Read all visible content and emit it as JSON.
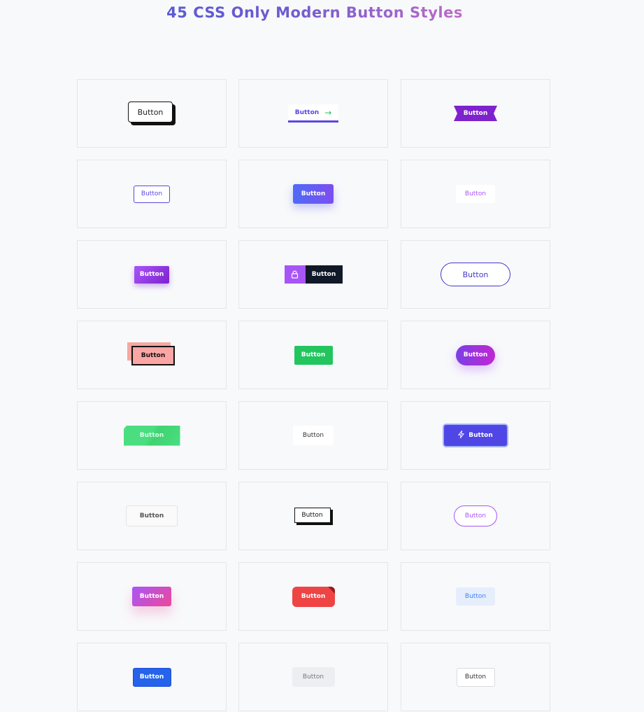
{
  "page": {
    "title": "45 CSS Only Modern Button Styles"
  },
  "buttons": [
    {
      "label": "Button"
    },
    {
      "label": "Button",
      "icon": "arrow-right-icon"
    },
    {
      "label": "Button"
    },
    {
      "label": "Button"
    },
    {
      "label": "Button"
    },
    {
      "label": "Button"
    },
    {
      "label": "Button"
    },
    {
      "label": "Button",
      "icon": "lock-icon"
    },
    {
      "label": "Button"
    },
    {
      "label": "Button"
    },
    {
      "label": "Button"
    },
    {
      "label": "Button"
    },
    {
      "label": "Button"
    },
    {
      "label": "Button"
    },
    {
      "label": "Button",
      "icon": "lightning-icon"
    },
    {
      "label": "Button"
    },
    {
      "label": "Button"
    },
    {
      "label": "Button"
    },
    {
      "label": "Button"
    },
    {
      "label": "Button"
    },
    {
      "label": "Button"
    },
    {
      "label": "Button"
    },
    {
      "label": "Button"
    },
    {
      "label": "Button"
    }
  ],
  "colors": {
    "background": "#f8f9fb",
    "card_border": "#e4e6ea",
    "title_gradient": [
      "#3b5bdb",
      "#6d5bd0",
      "#c26cc7",
      "#ec6b9e"
    ]
  }
}
